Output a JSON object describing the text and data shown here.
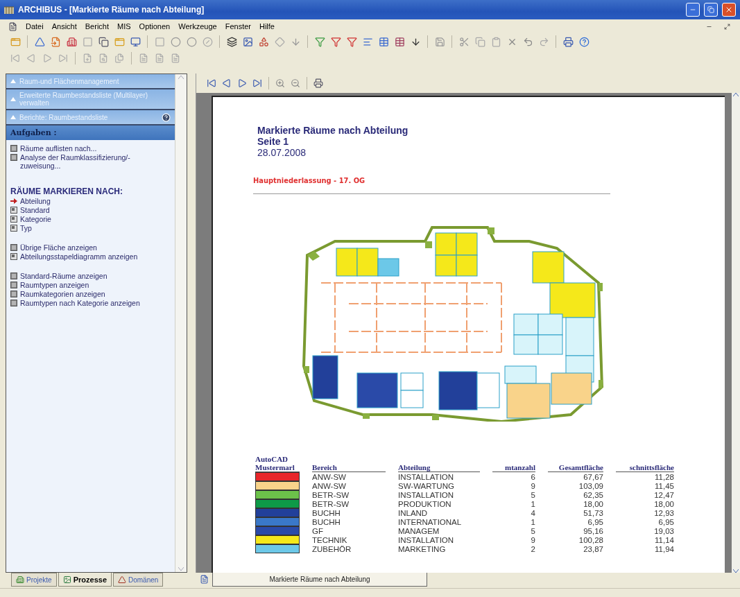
{
  "window": {
    "title": "ARCHIBUS - [Markierte Räume nach Abteilung]"
  },
  "menu": [
    "Datei",
    "Ansicht",
    "Bericht",
    "MIS",
    "Optionen",
    "Werkzeuge",
    "Fenster",
    "Hilfe"
  ],
  "process_panel": {
    "sections": [
      {
        "label": "Raum-und Flächenmanagement",
        "help": false
      },
      {
        "label": "Erweiterte Raumbestandsliste (Multilayer) verwalten",
        "help": false
      },
      {
        "label": "Berichte: Raumbestandsliste",
        "help": true
      }
    ],
    "tasks_header": "Aufgaben :",
    "groups": [
      {
        "items": [
          {
            "label": "Räume auflisten nach...",
            "kind": "report"
          },
          {
            "label": "Analyse der Raumklassifizierung/-zuweisung...",
            "kind": "report"
          }
        ]
      },
      {
        "title": "RÄUME MARKIEREN NACH:",
        "items": [
          {
            "label": "Abteilung",
            "kind": "drawing",
            "selected": true
          },
          {
            "label": "Standard",
            "kind": "drawing",
            "selected": false
          },
          {
            "label": "Kategorie",
            "kind": "drawing",
            "selected": false
          },
          {
            "label": "Typ",
            "kind": "drawing",
            "selected": false
          }
        ]
      },
      {
        "items": [
          {
            "label": "Übrige Fläche anzeigen",
            "kind": "report"
          },
          {
            "label": "Abteilungsstapeldiagramm anzeigen",
            "kind": "drawing"
          }
        ]
      },
      {
        "items": [
          {
            "label": "Standard-Räume anzeigen",
            "kind": "report"
          },
          {
            "label": "Raumtypen anzeigen",
            "kind": "report"
          },
          {
            "label": "Raumkategorien anzeigen",
            "kind": "report"
          },
          {
            "label": "Raumtypen nach Kategorie anzeigen",
            "kind": "report"
          }
        ]
      }
    ]
  },
  "panel_tabs": [
    {
      "label": "Projekte",
      "selected": false
    },
    {
      "label": "Prozesse",
      "selected": true
    },
    {
      "label": "Domänen",
      "selected": false
    }
  ],
  "report": {
    "title": "Markierte Räume nach Abteilung",
    "page": "Seite 1",
    "date": "28.07.2008",
    "site": "Hauptniederlassung - 17. OG",
    "legend": {
      "swatch_column": "AutoCAD Mustermarl",
      "columns": [
        "Bereich",
        "Abteilung",
        "mtanzahl",
        "Gesamtfläche",
        "schnittsfläche"
      ],
      "rows": [
        {
          "color": "#e8262a",
          "cells": [
            "ANW-SW",
            "INSTALLATION",
            "6",
            "67,67",
            "11,28"
          ]
        },
        {
          "color": "#f9d38a",
          "cells": [
            "ANW-SW",
            "SW-WARTUNG",
            "9",
            "103,09",
            "11,45"
          ]
        },
        {
          "color": "#6cc24a",
          "cells": [
            "BETR-SW",
            "INSTALLATION",
            "5",
            "62,35",
            "12,47"
          ]
        },
        {
          "color": "#0e9a48",
          "cells": [
            "BETR-SW",
            "PRODUKTION",
            "1",
            "18,00",
            "18,00"
          ]
        },
        {
          "color": "#22409a",
          "cells": [
            "BUCHH",
            "INLAND",
            "4",
            "51,73",
            "12,93"
          ]
        },
        {
          "color": "#3a78c8",
          "cells": [
            "BUCHH",
            "INTERNATIONAL",
            "1",
            "6,95",
            "6,95"
          ]
        },
        {
          "color": "#2a4aa8",
          "cells": [
            "GF",
            "MANAGEM",
            "5",
            "95,16",
            "19,03"
          ]
        },
        {
          "color": "#f5e81a",
          "cells": [
            "TECHNIK",
            "INSTALLATION",
            "9",
            "100,28",
            "11,14"
          ]
        },
        {
          "color": "#6cc8e8",
          "cells": [
            "ZUBEHÖR",
            "MARKETING",
            "2",
            "23,87",
            "11,94"
          ]
        }
      ]
    }
  },
  "doc_tabs": [
    {
      "label": "Markierte Räume nach Abteilung",
      "selected": true
    }
  ]
}
